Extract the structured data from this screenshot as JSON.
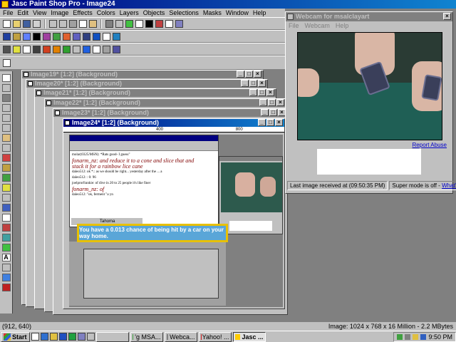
{
  "app": {
    "title": "Jasc Paint Shop Pro - Image24",
    "menu": [
      "File",
      "Edit",
      "View",
      "Image",
      "Effects",
      "Colors",
      "Layers",
      "Objects",
      "Selections",
      "Masks",
      "Window",
      "Help"
    ]
  },
  "document_windows": [
    {
      "title": "Image19* [1:2] (Background)"
    },
    {
      "title": "Image20* [1:2] (Background)"
    },
    {
      "title": "Image21* [1:2] (Background)"
    },
    {
      "title": "Image22* [1:2] (Background)"
    },
    {
      "title": "Image23* [1:2] (Background)"
    },
    {
      "title": "Image24* [1:2] (Background)",
      "ruler_marks": [
        "400",
        "800"
      ]
    }
  ],
  "image24_content": {
    "chat_lines": [
      "molar(0325/MSN): *Rats good- I guess\"",
      "fonarm_nz: and reduce it to a cone and slice that and",
      "stack it for a rainbow lice cane",
      "daleo512: ok   *.: as we should be right... yesterday after the ... a",
      "daleo512: : 0: 96",
      "joelprorfrankie: of dive in 20 to 25 people it's like finer",
      "fonarm_nz: of",
      "daleo512: \"ok, ferment \"a yn"
    ],
    "font_box": "Tahoma",
    "ad_text": "You have a 0.013 chance of being hit by a car on your way home."
  },
  "webcam": {
    "title": "Webcam for msalclayart",
    "menu": [
      "File",
      "Webcam",
      "Help"
    ],
    "report_link": "Report Abuse",
    "last_image": "Last image received at (09:50:35 PM)",
    "super_mode": "Super mode is off -",
    "whats_this": "What's this?"
  },
  "statusbar": {
    "coords": "(912, 640)",
    "image_info": "Image: 1024 x 768 x 16 Million - 2.2 MBytes"
  },
  "taskbar": {
    "start": "Start",
    "tasks": [
      {
        "label": "",
        "active": false
      },
      {
        "label": "'g MSA...",
        "active": false
      },
      {
        "label": "Webca...",
        "active": false
      },
      {
        "label": "Yahoo! ...",
        "active": false
      },
      {
        "label": "Jasc ...",
        "active": true
      }
    ],
    "clock": "9:50 PM"
  },
  "colors": {
    "active_title": "#000080",
    "face": "#c0c0c0",
    "workspace": "#808080"
  }
}
